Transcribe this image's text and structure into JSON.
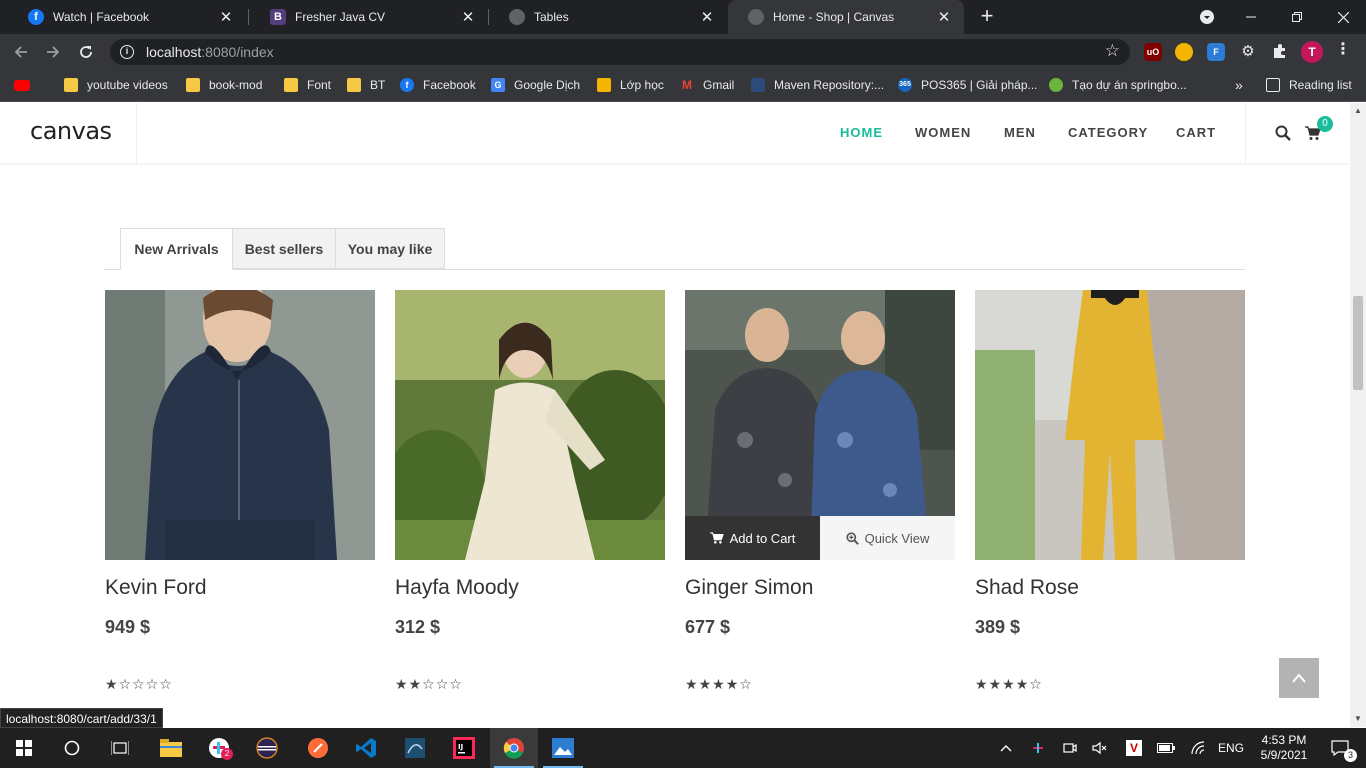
{
  "browser": {
    "tabs": [
      {
        "label": "Watch | Facebook",
        "icon": "facebook-icon",
        "color": "#1877f2",
        "glyph": "f"
      },
      {
        "label": "Fresher Java CV",
        "icon": "bootstrap-icon",
        "color": "#563d7c",
        "glyph": "B"
      },
      {
        "label": "Tables",
        "icon": "globe-icon",
        "color": "#5f6368",
        "glyph": ""
      },
      {
        "label": "Home - Shop | Canvas",
        "icon": "globe-icon",
        "color": "#5f6368",
        "glyph": "",
        "active": true
      }
    ],
    "close_glyph": "✕",
    "new_tab_glyph": "+",
    "url_host": "localhost",
    "url_rest": ":8080/index",
    "bookmarks": [
      {
        "label": "",
        "icon": "youtube-icon",
        "color": "#ff0000"
      },
      {
        "label": "youtube videos",
        "icon": "folder-icon"
      },
      {
        "label": "book-mod",
        "icon": "folder-icon"
      },
      {
        "label": "Font",
        "icon": "folder-icon"
      },
      {
        "label": "BT",
        "icon": "folder-icon"
      },
      {
        "label": "Facebook",
        "icon": "facebook-icon",
        "color": "#1877f2"
      },
      {
        "label": "Google Dịch",
        "icon": "google-translate-icon",
        "color": "#4285f4"
      },
      {
        "label": "Lớp học",
        "icon": "classroom-icon",
        "color": "#f4b400"
      },
      {
        "label": "Gmail",
        "icon": "gmail-icon",
        "color": "#ea4335"
      },
      {
        "label": "Maven Repository:...",
        "icon": "maven-icon",
        "color": "#2c4a7a"
      },
      {
        "label": "POS365 | Giải pháp...",
        "icon": "pos365-icon",
        "color": "#1565c0"
      },
      {
        "label": "Tạo dự án springbo...",
        "icon": "spring-icon",
        "color": "#6db33f"
      }
    ],
    "more_bookmarks": "»",
    "reading_list": "Reading list",
    "profile_initial": "T"
  },
  "site": {
    "logo": "canvas",
    "menu": [
      "HOME",
      "WOMEN",
      "MEN",
      "CATEGORY",
      "CART"
    ],
    "active_menu": "HOME",
    "cart_count": "0",
    "accent": "#1abc9c"
  },
  "product_tabs": [
    "New Arrivals",
    "Best sellers",
    "You may like"
  ],
  "active_product_tab": "New Arrivals",
  "products": [
    {
      "name": "Kevin Ford",
      "price": "949 $",
      "rating": 1,
      "image": "man-navy-hoodie"
    },
    {
      "name": "Hayfa Moody",
      "price": "312 $",
      "rating": 2,
      "image": "woman-floral-dress"
    },
    {
      "name": "Ginger Simon",
      "price": "677 $",
      "rating": 4,
      "image": "two-men-paisley-shirts",
      "hover": true
    },
    {
      "name": "Shad Rose",
      "price": "389 $",
      "rating": 4,
      "image": "woman-yellow-suit"
    }
  ],
  "hover_actions": {
    "add_to_cart": "Add to Cart",
    "quick_view": "Quick View"
  },
  "status_url": "localhost:8080/cart/add/33/1",
  "taskbar": {
    "time": "4:53 PM",
    "date": "5/9/2021",
    "lang": "ENG",
    "notifications": "3",
    "slack_badge": "2"
  }
}
